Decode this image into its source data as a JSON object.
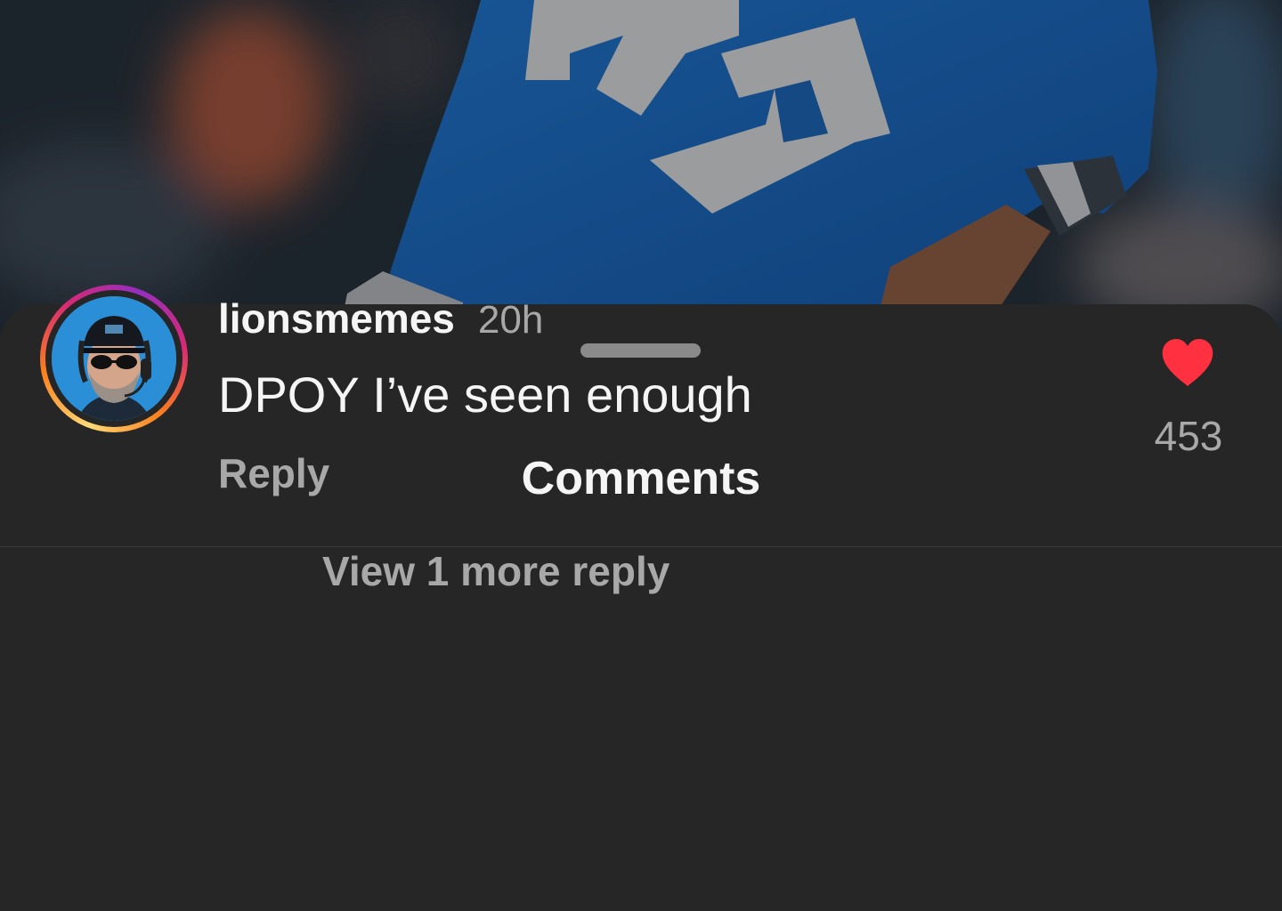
{
  "sheet": {
    "title": "Comments"
  },
  "comments": [
    {
      "username": "lionsmemes",
      "time": "20h",
      "text": "DPOY I’ve seen enough",
      "reply_label": "Reply",
      "like_icon": "heart-filled-icon",
      "like_color": "#ff3040",
      "like_count": "453",
      "view_replies_label": "View 1 more reply"
    }
  ],
  "colors": {
    "sheet_background": "#262626",
    "primary_text": "#f5f5f5",
    "secondary_text": "#a8a8a8",
    "jersey_blue": "#1f6fc4"
  }
}
